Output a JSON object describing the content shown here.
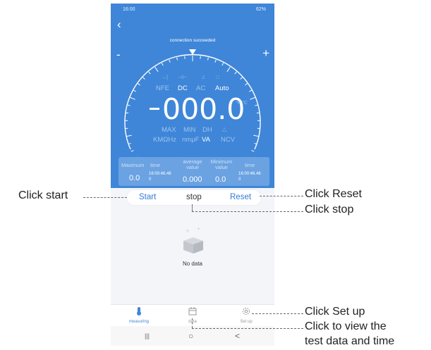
{
  "status_bar": {
    "time": "16:00",
    "right": "62%"
  },
  "header": {
    "connection": "connection succeeded",
    "zoom_out": "-",
    "zoom_in": "+"
  },
  "modes": {
    "row1": [
      "NFE",
      "DC",
      "AC",
      "Auto"
    ],
    "row1_active": [
      "DC",
      "Auto"
    ],
    "row2": [
      "MAX",
      "MIN",
      "DH"
    ],
    "row3": [
      "KMΩHz",
      "nmμF",
      "VA",
      "NCV"
    ]
  },
  "reading": {
    "value": "000.0",
    "unit": "°F °C"
  },
  "stats": {
    "maximum_label": "Maximum",
    "maximum_value": "0.0",
    "time1_label": "time",
    "time1_value": "16:00:46.46",
    "time1_sub": "0",
    "average_label": "average value",
    "average_value": "0.000",
    "minimum_label": "Minimum value",
    "minimum_value": "0.0",
    "time2_label": "time",
    "time2_value": "16:00:46.46",
    "time2_sub": "0"
  },
  "controls": {
    "start": "Start",
    "stop": "stop",
    "reset": "Reset"
  },
  "empty_state": {
    "text": "No data"
  },
  "tabs": [
    {
      "label": "measuring",
      "icon": "thermometer-icon"
    },
    {
      "label": "data",
      "icon": "calendar-icon"
    },
    {
      "label": "Set up",
      "icon": "gear-icon"
    }
  ],
  "nav": {
    "recents": "|||",
    "home": "○",
    "back": "<"
  },
  "callouts": {
    "start": "Click start",
    "reset": "Click Reset",
    "stop": "Click stop",
    "setup": "Click Set up",
    "data_line1": "Click to view the",
    "data_line2": "test data and time"
  },
  "colors": {
    "primary": "#3f86d8",
    "stats_panel": "#6aa2e2",
    "button_text": "#2f7cd6"
  }
}
